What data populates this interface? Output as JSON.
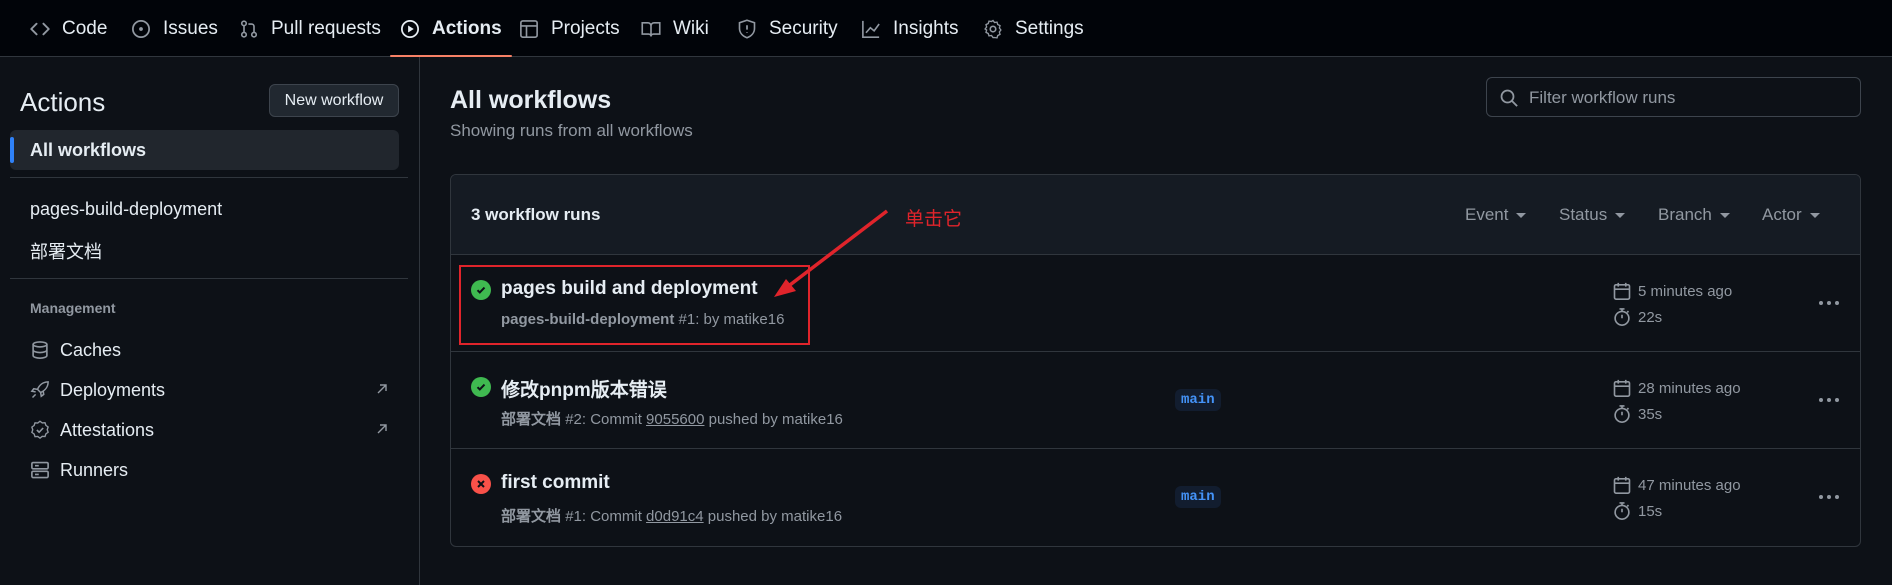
{
  "nav": {
    "tabs": [
      {
        "label": "Code",
        "icon": "code-icon"
      },
      {
        "label": "Issues",
        "icon": "issue-icon"
      },
      {
        "label": "Pull requests",
        "icon": "pull-request-icon"
      },
      {
        "label": "Actions",
        "icon": "play-icon",
        "active": true
      },
      {
        "label": "Projects",
        "icon": "table-icon"
      },
      {
        "label": "Wiki",
        "icon": "book-icon"
      },
      {
        "label": "Security",
        "icon": "shield-icon"
      },
      {
        "label": "Insights",
        "icon": "graph-icon"
      },
      {
        "label": "Settings",
        "icon": "gear-icon"
      }
    ]
  },
  "sidebar": {
    "title": "Actions",
    "new_workflow_label": "New workflow",
    "active_item": "All workflows",
    "workflows": [
      "pages-build-deployment",
      "部署文档"
    ],
    "management_label": "Management",
    "management": [
      {
        "label": "Caches",
        "icon": "database-icon"
      },
      {
        "label": "Deployments",
        "icon": "rocket-icon"
      },
      {
        "label": "Attestations",
        "icon": "verified-icon"
      },
      {
        "label": "Runners",
        "icon": "server-icon"
      }
    ]
  },
  "main": {
    "title": "All workflows",
    "subtitle": "Showing runs from all workflows",
    "filter_placeholder": "Filter workflow runs",
    "runs_count": "3 workflow runs",
    "filters": [
      "Event",
      "Status",
      "Branch",
      "Actor"
    ],
    "runs": [
      {
        "status": "success",
        "title": "pages build and deployment",
        "workflow": "pages-build-deployment",
        "meta": "#1: by matike16",
        "commit": "",
        "branch": "",
        "when": "5 minutes ago",
        "duration": "22s"
      },
      {
        "status": "success",
        "title": "修改pnpm版本错误",
        "workflow": "部署文档",
        "meta_prefix": "#2: Commit",
        "commit": "9055600",
        "meta_suffix": "pushed by matike16",
        "branch": "main",
        "when": "28 minutes ago",
        "duration": "35s"
      },
      {
        "status": "failure",
        "title": "first commit",
        "workflow": "部署文档",
        "meta_prefix": "#1: Commit",
        "commit": "d0d91c4",
        "meta_suffix": "pushed by matike16",
        "branch": "main",
        "when": "47 minutes ago",
        "duration": "15s"
      }
    ]
  },
  "annotation": {
    "text": "单击它",
    "color": "#e0242b"
  },
  "colors": {
    "background": "#0d1117",
    "header": "#010409",
    "accent": "#f78166",
    "success": "#3fb950",
    "failure": "#f85149",
    "link": "#4493f8"
  }
}
